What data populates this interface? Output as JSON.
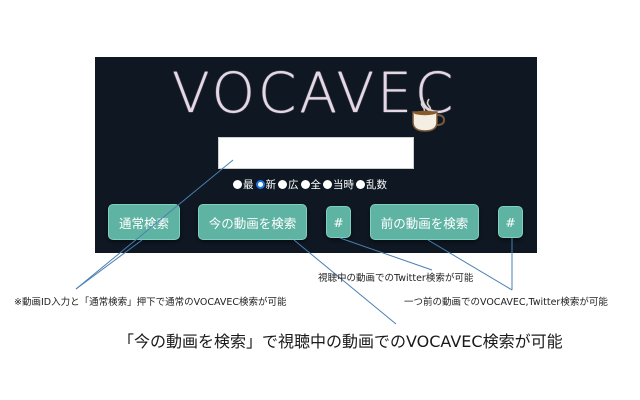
{
  "logo": {
    "text": "VOCAVEC"
  },
  "search": {
    "value": "",
    "placeholder": ""
  },
  "radio_options": [
    {
      "label": "最",
      "checked": false
    },
    {
      "label": "新",
      "checked": true
    },
    {
      "label": "広",
      "checked": false
    },
    {
      "label": "全",
      "checked": false
    },
    {
      "label": "当時",
      "checked": false
    },
    {
      "label": "乱数",
      "checked": false
    }
  ],
  "buttons": {
    "normal_search": "通常検索",
    "search_current": "今の動画を検索",
    "hash_current": "#",
    "search_previous": "前の動画を検索",
    "hash_previous": "#"
  },
  "notes": {
    "normal_search_note": "※動画ID入力と「通常検索」押下で通常のVOCAVEC検索が可能",
    "twitter_current_note": "視聴中の動画でのTwitter検索が可能",
    "previous_note": "一つ前の動画でのVOCAVEC,Twitter検索が可能",
    "current_search_note": "「今の動画を検索」で視聴中の動画でのVOCAVEC検索が可能"
  },
  "colors": {
    "panel_bg": "#0e1722",
    "button_teal": "#5fb3a3",
    "logo_text": "#e6d6e6",
    "annotation_line": "#4a7fb0"
  },
  "icons": {
    "cup": "coffee-cup-icon"
  }
}
